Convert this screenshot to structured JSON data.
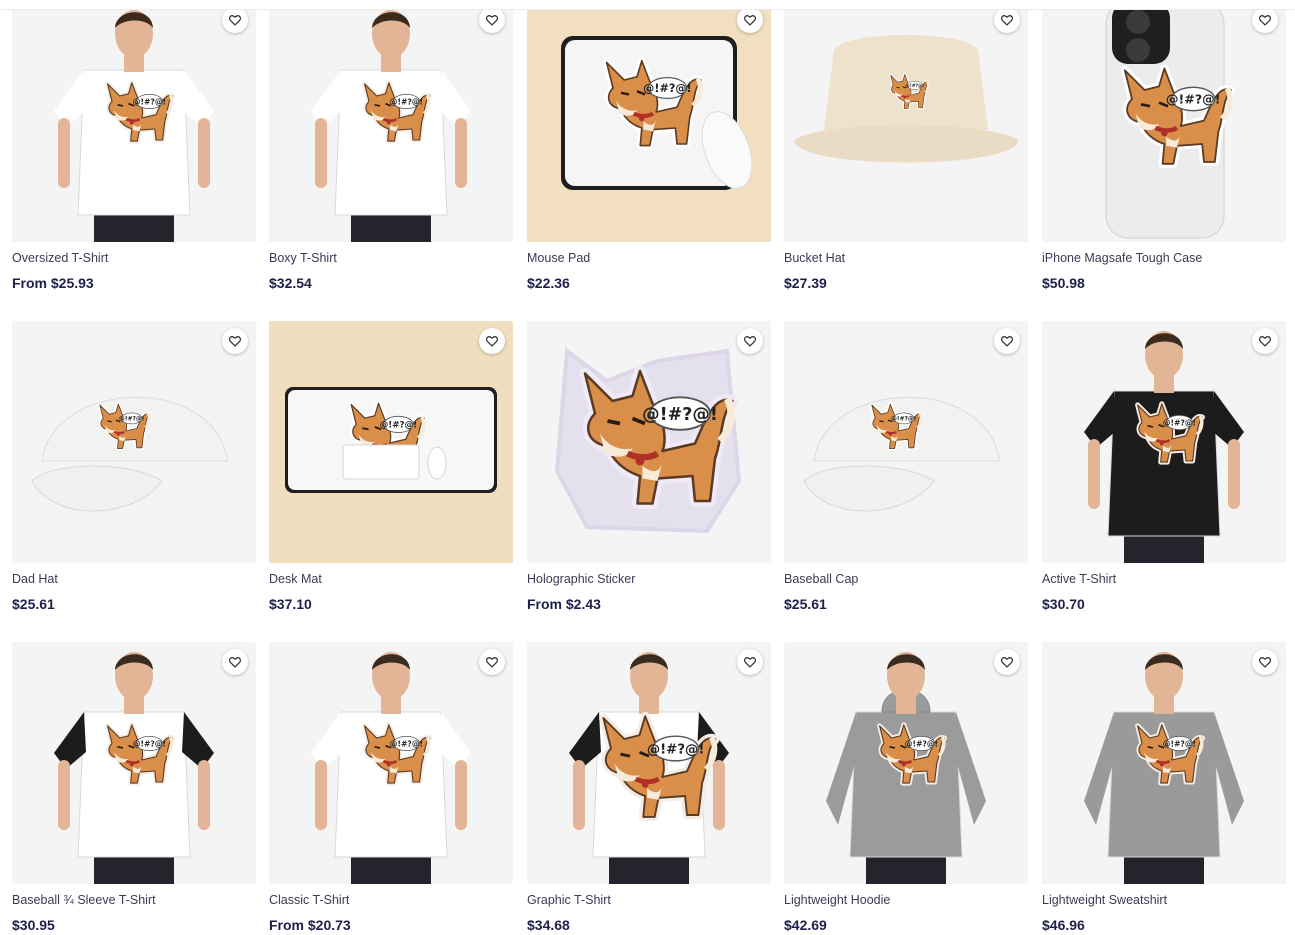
{
  "products": [
    {
      "title": "Oversized T-Shirt",
      "price": "From $25.93",
      "image": "oversized-tshirt-model",
      "bg": "#f4f4f4"
    },
    {
      "title": "Boxy T-Shirt",
      "price": "$32.54",
      "image": "boxy-tshirt-model",
      "bg": "#f4f4f4"
    },
    {
      "title": "Mouse Pad",
      "price": "$22.36",
      "image": "mouse-pad",
      "bg": "#f1dfc0"
    },
    {
      "title": "Bucket Hat",
      "price": "$27.39",
      "image": "bucket-hat",
      "bg": "#f4f4f4"
    },
    {
      "title": "iPhone Magsafe Tough Case",
      "price": "$50.98",
      "image": "phone-case",
      "bg": "#f4f4f4"
    },
    {
      "title": "Dad Hat",
      "price": "$25.61",
      "image": "dad-hat",
      "bg": "#f4f4f4"
    },
    {
      "title": "Desk Mat",
      "price": "$37.10",
      "image": "desk-mat",
      "bg": "#f0dfbf"
    },
    {
      "title": "Holographic Sticker",
      "price": "From $2.43",
      "image": "holographic-sticker",
      "bg": "#f4f4f4"
    },
    {
      "title": "Baseball Cap",
      "price": "$25.61",
      "image": "baseball-cap",
      "bg": "#f4f4f4"
    },
    {
      "title": "Active T-Shirt",
      "price": "$30.70",
      "image": "active-tshirt-model",
      "bg": "#f4f4f4"
    },
    {
      "title": "Baseball ¾ Sleeve T-Shirt",
      "price": "$30.95",
      "image": "baseball-sleeve-model",
      "bg": "#f4f4f4"
    },
    {
      "title": "Classic T-Shirt",
      "price": "From $20.73",
      "image": "classic-tshirt-model",
      "bg": "#f4f4f4"
    },
    {
      "title": "Graphic T-Shirt",
      "price": "$34.68",
      "image": "graphic-tshirt-model",
      "bg": "#f4f4f4"
    },
    {
      "title": "Lightweight Hoodie",
      "price": "$42.69",
      "image": "lightweight-hoodie-model",
      "bg": "#f4f4f4"
    },
    {
      "title": "Lightweight Sweatshirt",
      "price": "$46.96",
      "image": "lightweight-sweatshirt-model",
      "bg": "#f4f4f4"
    }
  ],
  "favorite_icon": "heart-outline-icon",
  "colors": {
    "price": "#1f1f4a",
    "title": "#3b3b55",
    "dog_fur": "#d98e4a",
    "dog_outline": "#5a3a22",
    "collar": "#b03028"
  }
}
